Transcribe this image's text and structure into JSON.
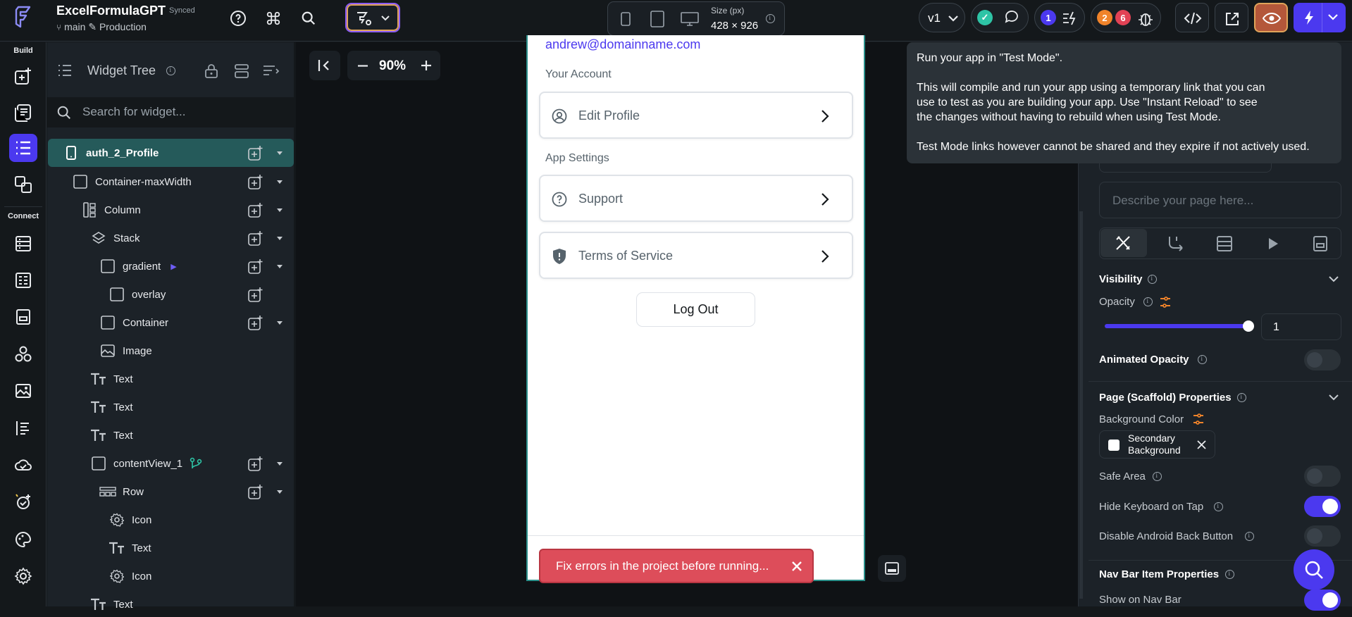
{
  "app": {
    "name": "ExcelFormulaGPT",
    "sync_status": "Synced",
    "branch": "main",
    "environment": "Production"
  },
  "topbar": {
    "size_label": "Size (px)",
    "size_value": "428 × 926",
    "version": "v1",
    "badge_blue": "1",
    "badge_orange": "2",
    "badge_red": "6"
  },
  "leftrail": {
    "build_label": "Build",
    "connect_label": "Connect"
  },
  "widget_tree": {
    "title": "Widget Tree",
    "search_placeholder": "Search for widget...",
    "nodes": [
      {
        "label": "auth_2_Profile",
        "icon": "phone-icon"
      },
      {
        "label": "Container-maxWidth",
        "icon": "container-icon"
      },
      {
        "label": "Column",
        "icon": "column-icon"
      },
      {
        "label": "Stack",
        "icon": "stack-icon"
      },
      {
        "label": "gradient",
        "icon": "container-icon"
      },
      {
        "label": "overlay",
        "icon": "container-icon"
      },
      {
        "label": "Container",
        "icon": "container-icon"
      },
      {
        "label": "Image",
        "icon": "image-icon"
      },
      {
        "label": "Text",
        "icon": "text-icon"
      },
      {
        "label": "Text",
        "icon": "text-icon"
      },
      {
        "label": "Text",
        "icon": "text-icon"
      },
      {
        "label": "contentView_1",
        "icon": "container-icon"
      },
      {
        "label": "Row",
        "icon": "row-icon"
      },
      {
        "label": "Icon",
        "icon": "gear-icon"
      },
      {
        "label": "Text",
        "icon": "text-icon"
      },
      {
        "label": "Icon",
        "icon": "gear-icon"
      },
      {
        "label": "Text",
        "icon": "text-icon"
      }
    ]
  },
  "canvas": {
    "zoom": "90%"
  },
  "preview": {
    "email": "andrew@domainname.com",
    "account_section": "Your Account",
    "edit_profile": "Edit Profile",
    "settings_section": "App Settings",
    "support": "Support",
    "terms": "Terms of Service",
    "logout": "Log Out",
    "error_toast": "Fix errors in the project before running..."
  },
  "tooltip": {
    "line1": "Run your app in \"Test Mode\".",
    "line2": "This will compile and run your app using a temporary link that you can\nuse to test as you are building your app. Use \"Instant Reload\" to see\nthe changes without having to rebuild when using Test Mode.",
    "line3": "Test Mode links however cannot be shared and they expire if not actively used."
  },
  "properties": {
    "describe_placeholder": "Describe your page here...",
    "visibility": "Visibility",
    "opacity_label": "Opacity",
    "opacity_value": "1",
    "opacity_fraction": 1,
    "animated_opacity": "Animated Opacity",
    "scaffold": "Page (Scaffold) Properties",
    "bg_color_label": "Background Color",
    "bg_color_value": "Secondary Background",
    "safe_area": "Safe Area",
    "hide_keyboard": "Hide Keyboard on Tap",
    "disable_back": "Disable Android Back Button",
    "navbar_props": "Nav Bar Item Properties",
    "show_navbar": "Show on Nav Bar"
  },
  "colors": {
    "accent": "#4b39ef",
    "teal": "#255a5a",
    "error": "#dd4d5a",
    "success": "#2ec4a6"
  }
}
